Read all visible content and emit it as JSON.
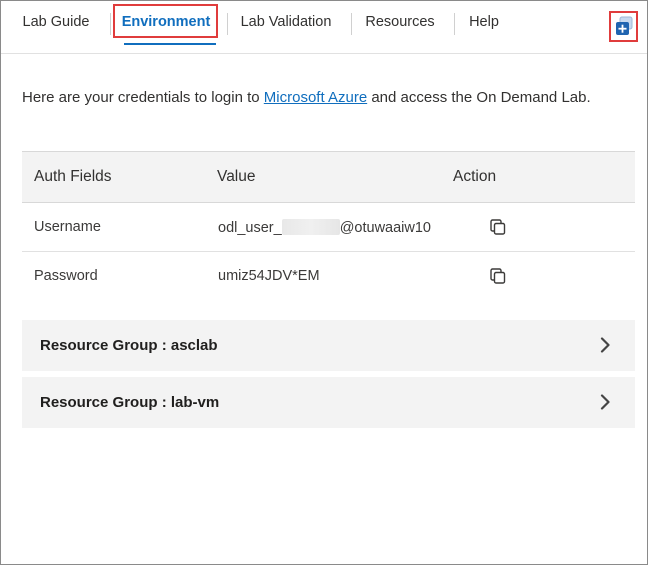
{
  "tabs": [
    {
      "label": "Lab Guide",
      "active": false
    },
    {
      "label": "Environment",
      "active": true
    },
    {
      "label": "Lab Validation",
      "active": false
    },
    {
      "label": "Resources",
      "active": false
    },
    {
      "label": "Help",
      "active": false
    }
  ],
  "intro": {
    "prefix": "Here are your credentials to login to ",
    "link_text": "Microsoft Azure",
    "suffix": " and access the On Demand Lab."
  },
  "credentials_table": {
    "headers": {
      "field": "Auth Fields",
      "value": "Value",
      "action": "Action"
    },
    "rows": [
      {
        "field": "Username",
        "value_prefix": "odl_user_",
        "value_suffix": "@otuwaaiw10"
      },
      {
        "field": "Password",
        "value": "umiz54JDV*EM"
      }
    ]
  },
  "resource_groups": [
    {
      "label": "Resource Group : asclab"
    },
    {
      "label": "Resource Group : lab-vm"
    }
  ],
  "colors": {
    "accent": "#106ebe",
    "highlight": "#e03c3c",
    "row_bg": "#f3f3f3"
  },
  "icons": {
    "copy": "copy-icon",
    "chevron": "chevron-right-icon",
    "corner": "add-window-icon"
  }
}
